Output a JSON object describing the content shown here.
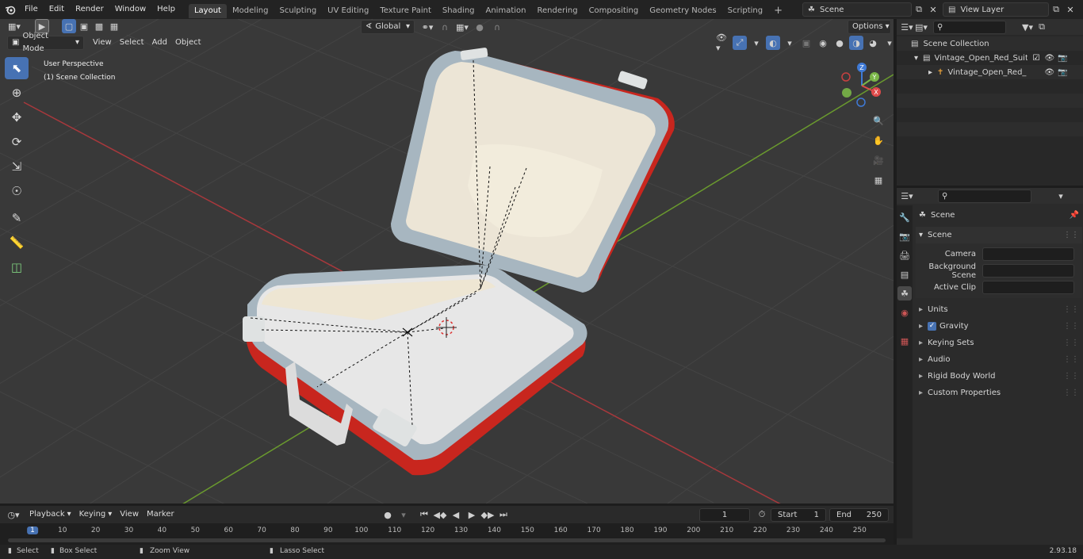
{
  "topbar": {
    "menus": [
      "File",
      "Edit",
      "Render",
      "Window",
      "Help"
    ],
    "workspaces": [
      "Layout",
      "Modeling",
      "Sculpting",
      "UV Editing",
      "Texture Paint",
      "Shading",
      "Animation",
      "Rendering",
      "Compositing",
      "Geometry Nodes",
      "Scripting"
    ],
    "active_workspace": "Layout",
    "add_tab": "+",
    "scene_name": "Scene",
    "view_layer": "View Layer"
  },
  "viewport": {
    "mode": "Object Mode",
    "menus": [
      "View",
      "Select",
      "Add",
      "Object"
    ],
    "orientation": "Global",
    "options_label": "Options",
    "info_line1": "User Perspective",
    "info_line2": "(1) Scene Collection",
    "gizmo": {
      "z": "Z",
      "y": "Y",
      "x": "X"
    }
  },
  "outliner": {
    "search_placeholder": "",
    "root": "Scene Collection",
    "collection": "Vintage_Open_Red_Suitcase_",
    "object": "Vintage_Open_Red_Suitc"
  },
  "properties": {
    "context_title": "Scene",
    "panel_title": "Scene",
    "fields": [
      {
        "label": "Camera",
        "value": ""
      },
      {
        "label": "Background Scene",
        "value": ""
      },
      {
        "label": "Active Clip",
        "value": ""
      }
    ],
    "sections": [
      {
        "label": "Units",
        "checkbox": false
      },
      {
        "label": "Gravity",
        "checkbox": true
      },
      {
        "label": "Keying Sets",
        "checkbox": false
      },
      {
        "label": "Audio",
        "checkbox": false
      },
      {
        "label": "Rigid Body World",
        "checkbox": false
      },
      {
        "label": "Custom Properties",
        "checkbox": false
      }
    ]
  },
  "timeline": {
    "menus": [
      "Playback",
      "Keying",
      "View",
      "Marker"
    ],
    "current_frame": "1",
    "start_label": "Start",
    "start": "1",
    "end_label": "End",
    "end": "250",
    "ticks": [
      "1",
      "10",
      "20",
      "30",
      "40",
      "50",
      "60",
      "70",
      "80",
      "90",
      "100",
      "110",
      "120",
      "130",
      "140",
      "150",
      "160",
      "170",
      "180",
      "190",
      "200",
      "210",
      "220",
      "230",
      "240",
      "250"
    ]
  },
  "statusbar": {
    "select": "Select",
    "box_select": "Box Select",
    "zoom_view": "Zoom View",
    "lasso_select": "Lasso Select",
    "version": "2.93.18"
  },
  "colors": {
    "accent": "#4772b3",
    "suitcase_red": "#c8261e",
    "x_axis": "#a8383c",
    "y_axis": "#6a9a2e",
    "origin": "#e8a23a"
  }
}
